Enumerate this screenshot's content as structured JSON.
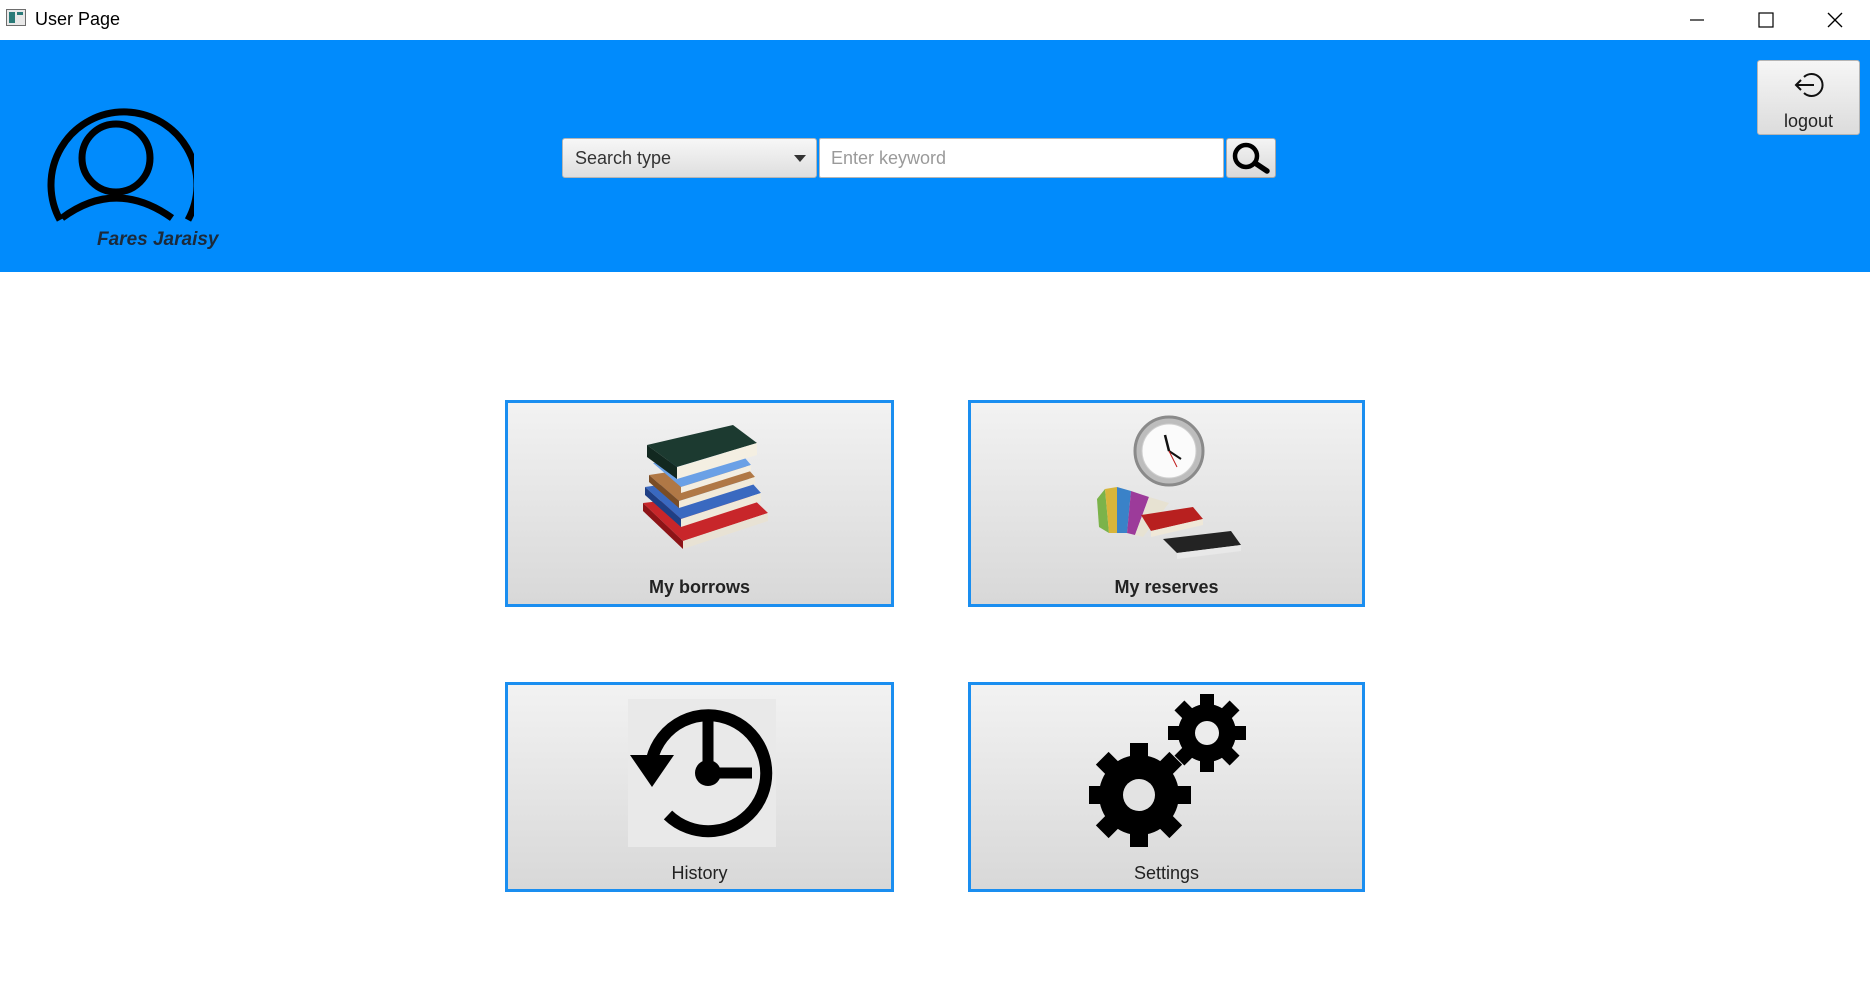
{
  "window": {
    "title": "User Page",
    "controls": [
      "minimize",
      "maximize",
      "close"
    ]
  },
  "header": {
    "background": "#018bfc",
    "avatar_icon": "user-circle-icon",
    "username": "Fares Jaraisy",
    "search": {
      "type_label": "Search type",
      "keyword_placeholder": "Enter keyword",
      "keyword_value": "",
      "button_icon": "magnifier-icon"
    },
    "logout": {
      "label": "logout",
      "icon": "logout-icon"
    }
  },
  "tiles": [
    {
      "label": "My borrows",
      "icon": "book-stack-icon"
    },
    {
      "label": "My reserves",
      "icon": "clock-books-icon"
    },
    {
      "label": "History",
      "icon": "history-clock-icon"
    },
    {
      "label": "Settings",
      "icon": "gears-icon"
    }
  ],
  "colors": {
    "accent": "#1a8ef0",
    "tile_bg": "#e6e6e6"
  }
}
